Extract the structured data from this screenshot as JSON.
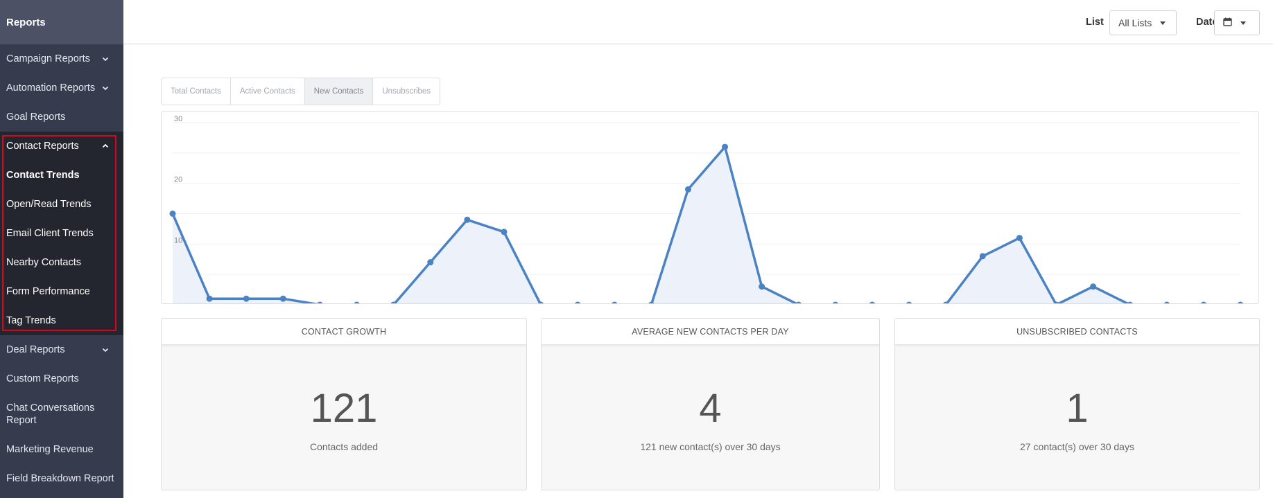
{
  "sidebar": {
    "title": "Reports",
    "items_top": [
      {
        "label": "Campaign Reports",
        "chevron": "down"
      },
      {
        "label": "Automation Reports",
        "chevron": "down"
      },
      {
        "label": "Goal Reports"
      }
    ],
    "contact_group": {
      "label": "Contact Reports",
      "chevron": "up",
      "children": [
        "Contact Trends",
        "Open/Read Trends",
        "Email Client Trends",
        "Nearby Contacts",
        "Form Performance",
        "Tag Trends"
      ],
      "active_child": "Contact Trends"
    },
    "items_bottom": [
      {
        "label": "Deal Reports",
        "chevron": "down"
      },
      {
        "label": "Custom Reports"
      },
      {
        "label": "Chat Conversations Report"
      },
      {
        "label": "Marketing Revenue"
      },
      {
        "label": "Field Breakdown Report"
      }
    ]
  },
  "topbar": {
    "list_label": "List",
    "list_value": "All Lists",
    "date_label": "Date",
    "date_icon": "calendar-icon"
  },
  "tabs": [
    {
      "label": "Total Contacts",
      "active": false
    },
    {
      "label": "Active Contacts",
      "active": false
    },
    {
      "label": "New Contacts",
      "active": true
    },
    {
      "label": "Unsubscribes",
      "active": false
    }
  ],
  "chart_data": {
    "type": "area",
    "x": [
      1,
      2,
      3,
      4,
      5,
      6,
      7,
      8,
      9,
      10,
      11,
      12,
      13,
      14,
      15,
      16,
      17,
      18,
      19,
      20,
      21,
      22,
      23,
      24,
      25,
      26,
      27,
      28,
      29,
      30
    ],
    "values": [
      15,
      1,
      1,
      1,
      0,
      0,
      0,
      7,
      14,
      12,
      0,
      0,
      0,
      0,
      19,
      26,
      3,
      0,
      0,
      0,
      0,
      0,
      8,
      11,
      0,
      3,
      0,
      0,
      0,
      0
    ],
    "ylim": [
      0,
      30
    ],
    "yticks": [
      10,
      20,
      30
    ],
    "line_color": "#4a82c3",
    "fill_color": "#edf2fa",
    "grid": true
  },
  "cards": [
    {
      "title": "CONTACT GROWTH",
      "value": "121",
      "subtitle": "Contacts added"
    },
    {
      "title": "AVERAGE NEW CONTACTS PER DAY",
      "value": "4",
      "subtitle": "121 new contact(s) over 30 days"
    },
    {
      "title": "UNSUBSCRIBED CONTACTS",
      "value": "1",
      "subtitle": "27 contact(s) over 30 days"
    }
  ],
  "colors": {
    "sidebar_bg": "#373b4e",
    "sidebar_header_bg": "#4d5166",
    "sidebar_group_bg": "#23262f",
    "highlight_outline": "#e3001b"
  }
}
